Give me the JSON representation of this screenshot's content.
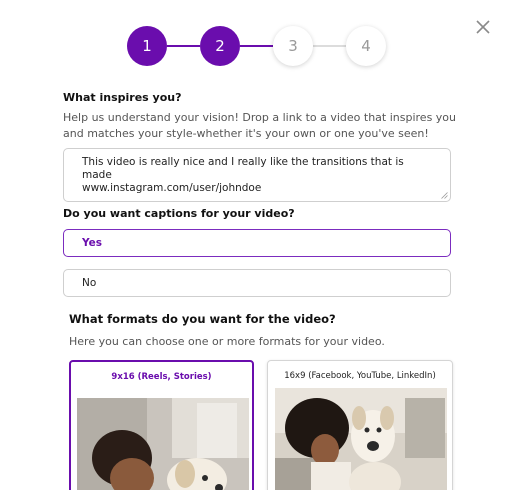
{
  "stepper": {
    "steps": [
      {
        "label": "1",
        "state": "done"
      },
      {
        "label": "2",
        "state": "done"
      },
      {
        "label": "3",
        "state": "todo"
      },
      {
        "label": "4",
        "state": "todo"
      }
    ],
    "accent_color": "#6a0dad"
  },
  "close_icon": "close-icon",
  "inspiration": {
    "title": "What inspires you?",
    "help": "Help us understand your vision! Drop a link to a video that inspires you and matches your style-whether it's your own or one you've seen!",
    "value_line1": "This video is really nice and I really like the transitions that is made",
    "value_line2": "www.instagram.com/user/johndoe"
  },
  "captions": {
    "title": "Do you want captions for your video?",
    "options": [
      "Yes",
      "No"
    ],
    "selected": "Yes"
  },
  "formats": {
    "title": "What formats do you want for the video?",
    "help": "Here you can choose one or more formats for your video.",
    "cards": [
      {
        "label": "9x16 (Reels, Stories)",
        "selected": true
      },
      {
        "label": "16x9 (Facebook, YouTube, LinkedIn)",
        "selected": false
      }
    ]
  }
}
